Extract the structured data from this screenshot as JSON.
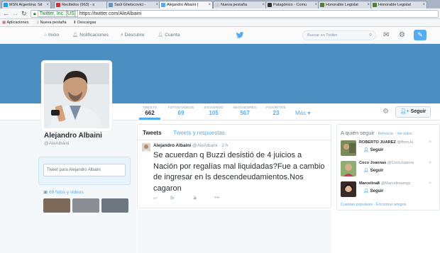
{
  "browser": {
    "tabs": [
      {
        "title": "MSN Argentina: Sit",
        "fav": "#1ba1e2"
      },
      {
        "title": "Recibidos (963) - s",
        "fav": "#c33"
      },
      {
        "title": "Saúl Ghetscovici - ",
        "fav": "#6b8fbf"
      },
      {
        "title": "Alejandro Albaini (",
        "fav": "#55acee"
      },
      {
        "title": "Nueva pestaña",
        "fav": "#ccc"
      },
      {
        "title": "Patagónico - Comu",
        "fav": "#333"
      },
      {
        "title": "Honorable Legislat",
        "fav": "#5a7a3a"
      },
      {
        "title": "Honorable Legislat",
        "fav": "#5a7a3a"
      }
    ],
    "url_org": "Twitter, Inc. [US]",
    "url": "https://twitter.com/AleAlbaini",
    "bookmarks": [
      "Aplicaciones",
      "Nueva pestaña",
      "Descargas"
    ]
  },
  "topnav": {
    "home": "Inicio",
    "notifications": "Notificaciones",
    "discover": "Descubre",
    "account": "Cuenta",
    "search_placeholder": "Buscar en Twitter"
  },
  "profile": {
    "name": "Alejandro Albaini",
    "handle": "@AleAlbaini",
    "tweet_to": "Tweet para Alejandro Albaini",
    "photos": "69 fotos y videos",
    "follow": "Seguir",
    "more": "Más",
    "stats": [
      {
        "label": "TWEETS",
        "value": "662"
      },
      {
        "label": "FOTOS/VIDEOS",
        "value": "69"
      },
      {
        "label": "SIGUIENDO",
        "value": "105"
      },
      {
        "label": "SEGUIDORES",
        "value": "567"
      },
      {
        "label": "FAVORITOS",
        "value": "23"
      }
    ]
  },
  "timeline": {
    "tab_tweets": "Tweets",
    "tab_replies": "Tweets y respuestas",
    "tweet": {
      "name": "Alejandro Albaini",
      "handle": "@AleAlbaini",
      "time": "· 2 h",
      "text": "Se acuerdan q Buzzi desistió de 4 juicios a Nación por regalías mal liquidadas?Fue a cambio de ingresar en ls descendeudamientos.Nos cagaron",
      "retweets": "5",
      "favorites": "2"
    }
  },
  "who_to_follow": {
    "title": "A quién seguir",
    "refresh": "· Refrescar",
    "view_all": "· Ver todos",
    "follow": "Seguir",
    "items": [
      {
        "name": "ROBERTO JUAREZ",
        "handle": "@fforoJu"
      },
      {
        "name": "Coco Joannas",
        "handle": "@CocoJoanna"
      },
      {
        "name": "Marcelina8",
        "handle": "@Marcelinaangc"
      }
    ],
    "footer": "Cuentas populares · Encontrar amigos"
  },
  "colors": {
    "accent": "#55acee",
    "banner": "#4a8ec2"
  }
}
